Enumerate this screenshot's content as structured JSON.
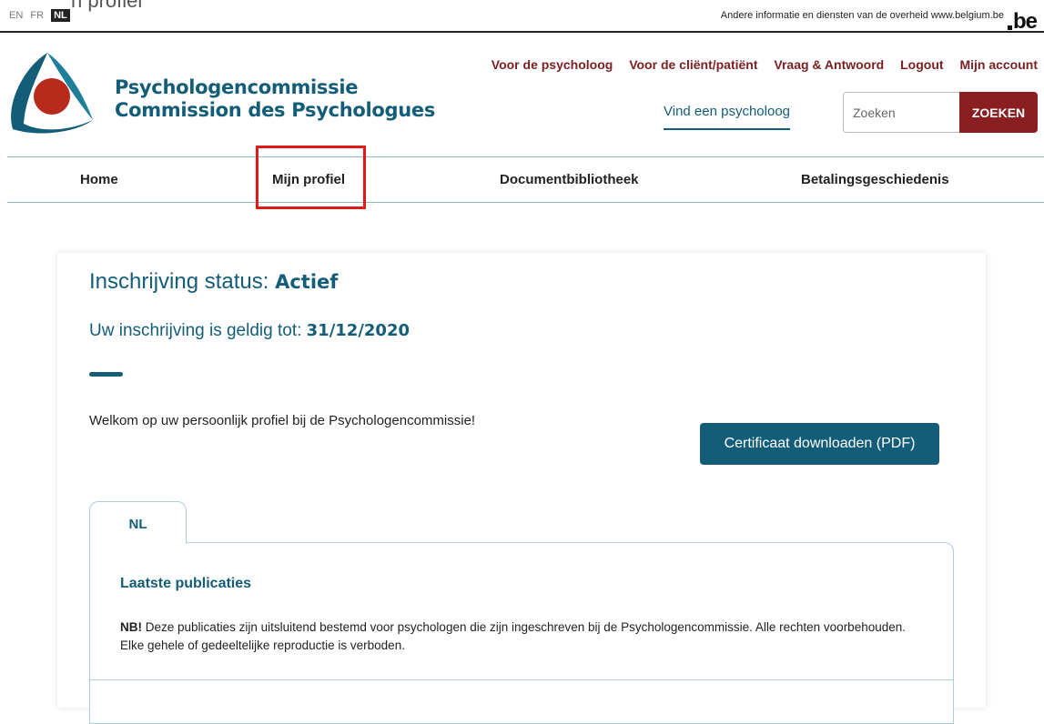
{
  "fedbar": {
    "cut_text": "n profiel",
    "languages": [
      {
        "code": "EN",
        "active": false
      },
      {
        "code": "FR",
        "active": false
      },
      {
        "code": "NL",
        "active": true
      }
    ],
    "info_text": "Andere informatie en diensten van de overheid www.belgium.be",
    "logo_text": "be"
  },
  "header": {
    "brand_line1": "Psychologencommissie",
    "brand_line2": "Commission des Psychologues",
    "top_links": [
      "Voor de psycholoog",
      "Voor de cliënt/patiënt",
      "Vraag & Antwoord",
      "Logout",
      "Mijn account"
    ],
    "find_psychologist": "Vind een psycholoog",
    "search": {
      "placeholder": "Zoeken",
      "button_label": "ZOEKEN"
    }
  },
  "mainnav": {
    "items": [
      "Home",
      "Mijn profiel",
      "Documentbibliotheek",
      "Betalingsgeschiedenis"
    ],
    "highlighted": "Mijn profiel"
  },
  "card": {
    "status_label": "Inschrijving status:",
    "status_value": "Actief",
    "valid_label": "Uw inschrijving is geldig tot:",
    "valid_value": "31/12/2020",
    "welcome": "Welkom op uw persoonlijk profiel bij de Psychologencommissie!",
    "cert_button": "Certificaat downloaden (PDF)",
    "tab_label": "NL",
    "publications_title": "Laatste publicaties",
    "note_prefix": "NB!",
    "note_text": "Deze publicaties zijn uitsluitend bestemd voor psychologen die zijn ingeschreven bij de Psychologencommissie. Alle rechten voorbehouden. Elke gehele of gedeeltelijke reproductie is verboden."
  },
  "colors": {
    "teal": "#135d78",
    "maroon": "#8a1f22",
    "logo_red": "#b72a1c",
    "highlight": "#e31919"
  },
  "icons": {
    "logo": "psychologencommissie-logo",
    "be": "belgium-be-logo"
  }
}
